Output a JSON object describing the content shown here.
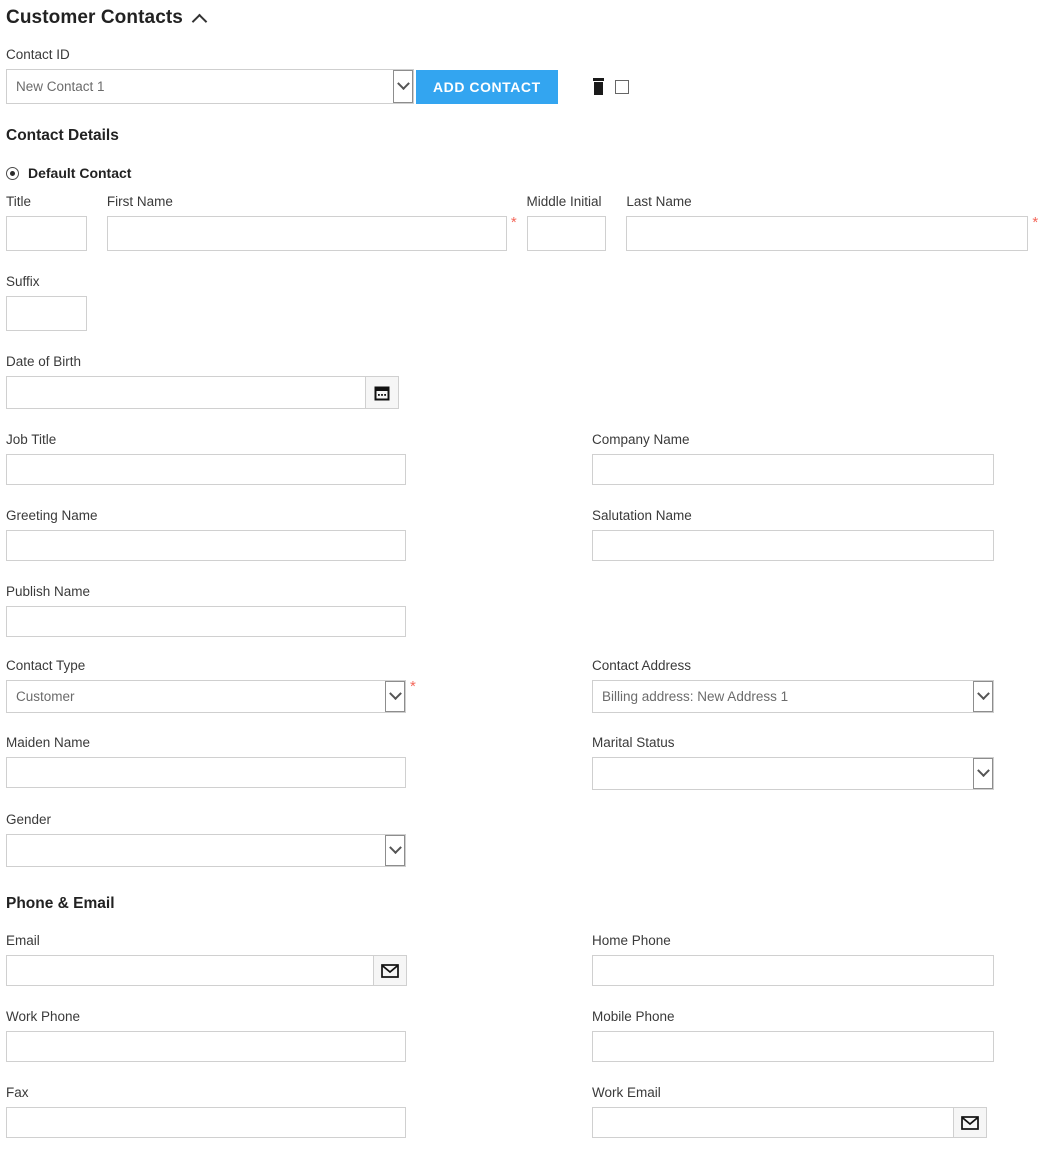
{
  "panel": {
    "title": "Customer Contacts",
    "collapse_icon": "chevron-up-icon"
  },
  "contact_id": {
    "label": "Contact ID",
    "selected": "New Contact 1",
    "options": [
      "New Contact 1"
    ],
    "add_button": "ADD CONTACT",
    "delete_icon": "trash-icon",
    "checkbox_icon": "checkbox-icon"
  },
  "contact_details": {
    "heading": "Contact Details",
    "default_contact_label": "Default Contact",
    "fields": {
      "title": {
        "label": "Title",
        "value": ""
      },
      "first_name": {
        "label": "First Name",
        "value": "",
        "required": "*"
      },
      "middle_initial": {
        "label": "Middle Initial",
        "value": ""
      },
      "last_name": {
        "label": "Last Name",
        "value": "",
        "required": "*"
      },
      "suffix": {
        "label": "Suffix",
        "value": ""
      },
      "date_of_birth": {
        "label": "Date of Birth",
        "value": "",
        "icon": "calendar-icon"
      },
      "job_title": {
        "label": "Job Title",
        "value": ""
      },
      "company_name": {
        "label": "Company Name",
        "value": ""
      },
      "greeting_name": {
        "label": "Greeting Name",
        "value": ""
      },
      "salutation_name": {
        "label": "Salutation Name",
        "value": ""
      },
      "publish_name": {
        "label": "Publish Name",
        "value": ""
      },
      "contact_type": {
        "label": "Contact Type",
        "selected": "Customer",
        "required": "*"
      },
      "contact_address": {
        "label": "Contact Address",
        "selected": "Billing address: New Address 1"
      },
      "maiden_name": {
        "label": "Maiden Name",
        "value": ""
      },
      "marital_status": {
        "label": "Marital Status",
        "selected": ""
      },
      "gender": {
        "label": "Gender",
        "selected": ""
      }
    }
  },
  "phone_email": {
    "heading": "Phone & Email",
    "fields": {
      "email": {
        "label": "Email",
        "value": "",
        "icon": "envelope-icon"
      },
      "home_phone": {
        "label": "Home Phone",
        "value": ""
      },
      "work_phone": {
        "label": "Work Phone",
        "value": ""
      },
      "mobile_phone": {
        "label": "Mobile Phone",
        "value": ""
      },
      "fax": {
        "label": "Fax",
        "value": ""
      },
      "work_email": {
        "label": "Work Email",
        "value": "",
        "icon": "envelope-icon"
      }
    }
  },
  "colors": {
    "accent": "#33a5f0",
    "required": "#f4675a",
    "border": "#d0d0d0"
  }
}
